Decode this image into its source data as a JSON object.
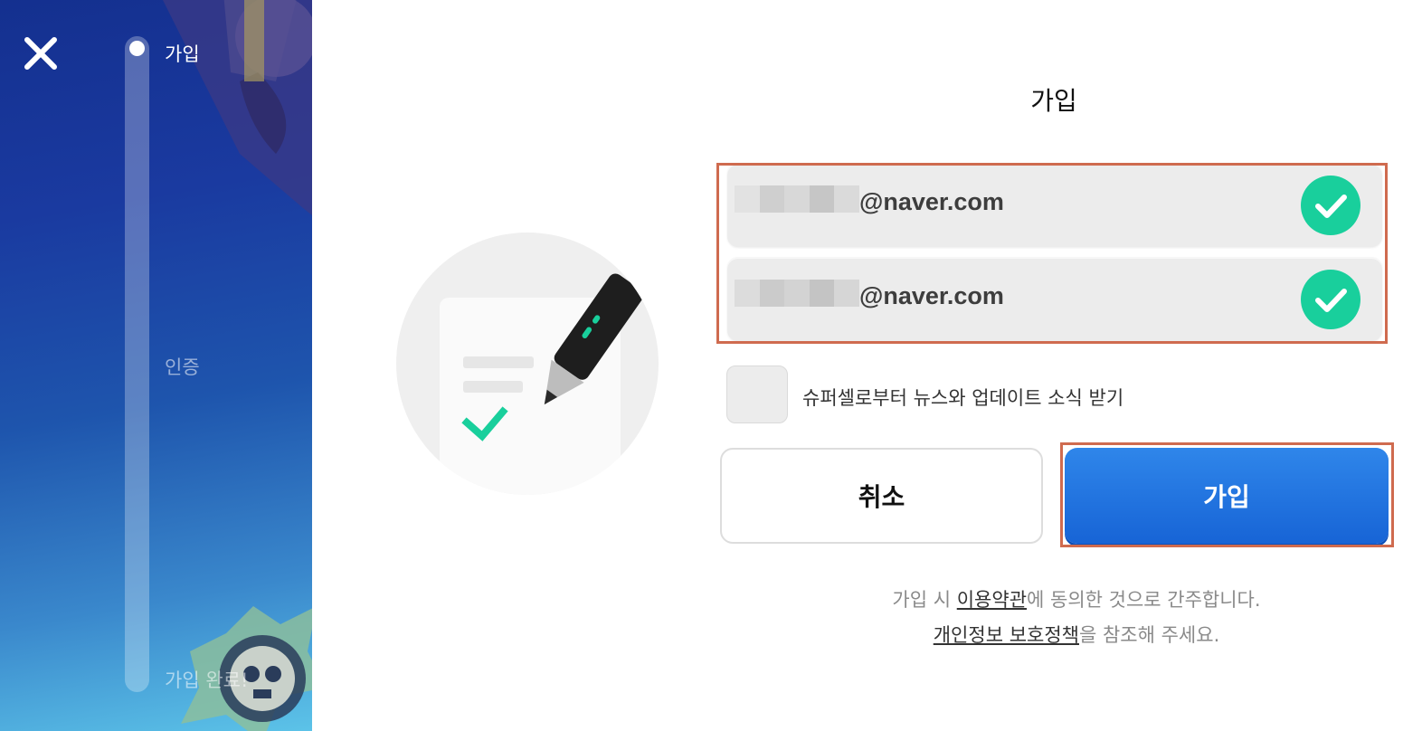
{
  "steps": [
    {
      "label": "가입",
      "active": true
    },
    {
      "label": "인증",
      "active": false
    },
    {
      "label": "가입 완료!",
      "active": false
    }
  ],
  "form": {
    "title": "가입",
    "email_value": "@naver.com",
    "confirm_email_value": "@naver.com",
    "newsletter_label": "슈퍼셀로부터 뉴스와 업데이트 소식 받기",
    "newsletter_checked": false,
    "cancel_label": "취소",
    "submit_label": "가입"
  },
  "legal": {
    "line1_prefix": "가입 시 ",
    "terms_link": "이용약관",
    "line1_suffix": "에 동의한 것으로 간주합니다.",
    "privacy_link": "개인정보 보호정책",
    "line2_suffix": "을 참조해 주세요."
  },
  "icons": {
    "close": "close-icon",
    "check": "check-icon",
    "illustration": "signup-pen-document-illustration"
  },
  "colors": {
    "accent_blue": "#1f6fe0",
    "valid_green": "#19cf9c",
    "highlight": "#cf6b4f"
  }
}
